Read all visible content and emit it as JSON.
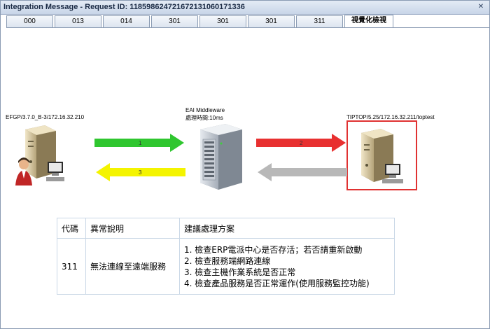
{
  "window": {
    "title": "Integration Message - Request ID: 118598624721672131060171336",
    "close_icon": "close-icon"
  },
  "tabs": [
    {
      "label": "000",
      "active": false
    },
    {
      "label": "013",
      "active": false
    },
    {
      "label": "014",
      "active": false
    },
    {
      "label": "301",
      "active": false
    },
    {
      "label": "301",
      "active": false
    },
    {
      "label": "301",
      "active": false
    },
    {
      "label": "311",
      "active": false
    },
    {
      "label": "視覺化檢視",
      "active": true
    }
  ],
  "diagram": {
    "left_node": {
      "label": "EFGP/3.7.0_B-3/172.16.32.210",
      "icon": "server-user-icon"
    },
    "middle_node": {
      "label": "EAI Middleware",
      "timing": "處理時間:10ms",
      "icon": "rack-server-icon"
    },
    "right_node": {
      "label": "TIPTOP/5.25/172.16.32.211/toptest",
      "icon": "server-workstation-icon"
    },
    "arrows": [
      {
        "label": "1",
        "color": "#2fc62f",
        "direction": "right"
      },
      {
        "label": "2",
        "color": "#e83030",
        "direction": "right"
      },
      {
        "label": "3",
        "color": "#f4f400",
        "direction": "left"
      },
      {
        "label": "",
        "color": "#b8b8b8",
        "direction": "left"
      }
    ],
    "highlight_color": "#e03232"
  },
  "error_table": {
    "headers": [
      "代碼",
      "異常說明",
      "建議處理方案"
    ],
    "row": {
      "code": "311",
      "description": "無法連線至遠端服務",
      "solutions": [
        "1. 檢查ERP電派中心是否存活；若否請重新啟動",
        "2. 檢查服務端網路連線",
        "3. 檢查主機作業系統是否正常",
        "4. 檢查產品服務是否正常運作(使用服務監控功能)"
      ]
    }
  }
}
